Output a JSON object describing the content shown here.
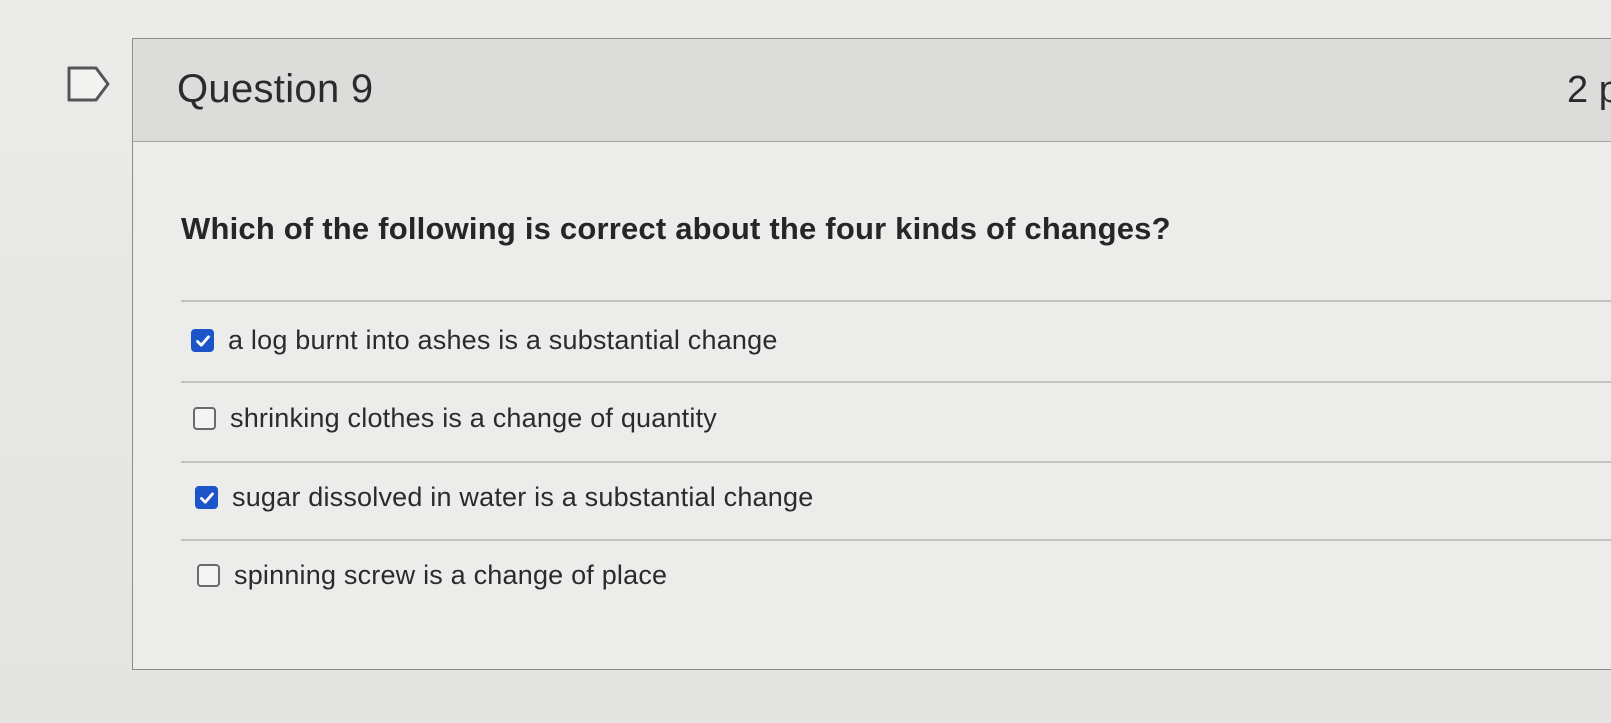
{
  "question": {
    "title": "Question 9",
    "points": "2 p",
    "text": "Which of the following is correct about the four kinds of changes?"
  },
  "options": [
    {
      "label": "a log burnt into ashes is a substantial change",
      "checked": true
    },
    {
      "label": "shrinking clothes is a change of quantity",
      "checked": false
    },
    {
      "label": "sugar dissolved in water is a substantial change",
      "checked": true
    },
    {
      "label": "spinning screw is a change of place",
      "checked": false
    }
  ],
  "colors": {
    "checkbox_checked": "#1b55c9",
    "header_bg": "#dcdcda",
    "text": "#2b2b2b"
  }
}
